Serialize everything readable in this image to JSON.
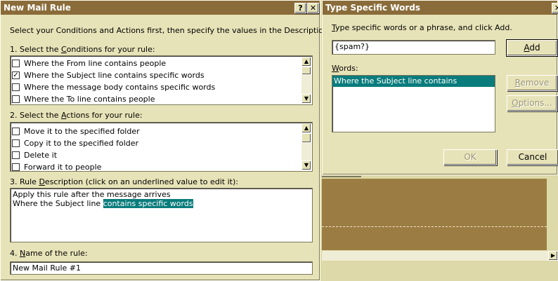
{
  "new_mail_rule": {
    "title": "New Mail Rule",
    "help_button": "?",
    "close_button": "x",
    "instructions": "Select your Conditions and Actions first, then specify the values in the Description.",
    "step1_pre": "1. Select the ",
    "step1_key": "C",
    "step1_post": "onditions for your rule:",
    "conditions": [
      {
        "label": "Where the From line contains people",
        "checked": false
      },
      {
        "label": "Where the Subject line contains specific words",
        "checked": true
      },
      {
        "label": "Where the message body contains specific words",
        "checked": false
      },
      {
        "label": "Where the To line contains people",
        "checked": false
      }
    ],
    "step2_pre": "2. Select the ",
    "step2_key": "A",
    "step2_post": "ctions for your rule:",
    "actions": [
      {
        "label": "Move it to the specified folder",
        "checked": false
      },
      {
        "label": "Copy it to the specified folder",
        "checked": false
      },
      {
        "label": "Delete it",
        "checked": false
      },
      {
        "label": "Forward it to people",
        "checked": false
      }
    ],
    "step3_pre": "3. Rule ",
    "step3_key": "D",
    "step3_post": "escription (click on an underlined value to edit it):",
    "description_line1": "Apply this rule after the message arrives",
    "description_line2_prefix": "Where the Subject line ",
    "description_line2_link": "contains specific words",
    "step4_pre": "4. ",
    "step4_key": "N",
    "step4_post": "ame of the rule:",
    "rule_name": "New Mail Rule #1"
  },
  "type_specific_words": {
    "title": "Type Specific Words",
    "close_button": "x",
    "prompt_key": "T",
    "prompt_rest": "ype specific words or a phrase, and click Add.",
    "input_value": "{spam?}",
    "add_key": "A",
    "add_rest": "dd",
    "words_key": "W",
    "words_rest": "ords:",
    "words": [
      "Where the Subject line contains"
    ],
    "remove_key": "R",
    "remove_rest": "emove",
    "options_key": "O",
    "options_rest": "ptions...",
    "ok_label": "OK",
    "cancel_label": "Cancel"
  },
  "colors": {
    "titlebar": "#8a6c3a",
    "dialog_face": "#e7e3b8",
    "selection": "#0a7c7c",
    "desktop": "#9b7d43"
  }
}
